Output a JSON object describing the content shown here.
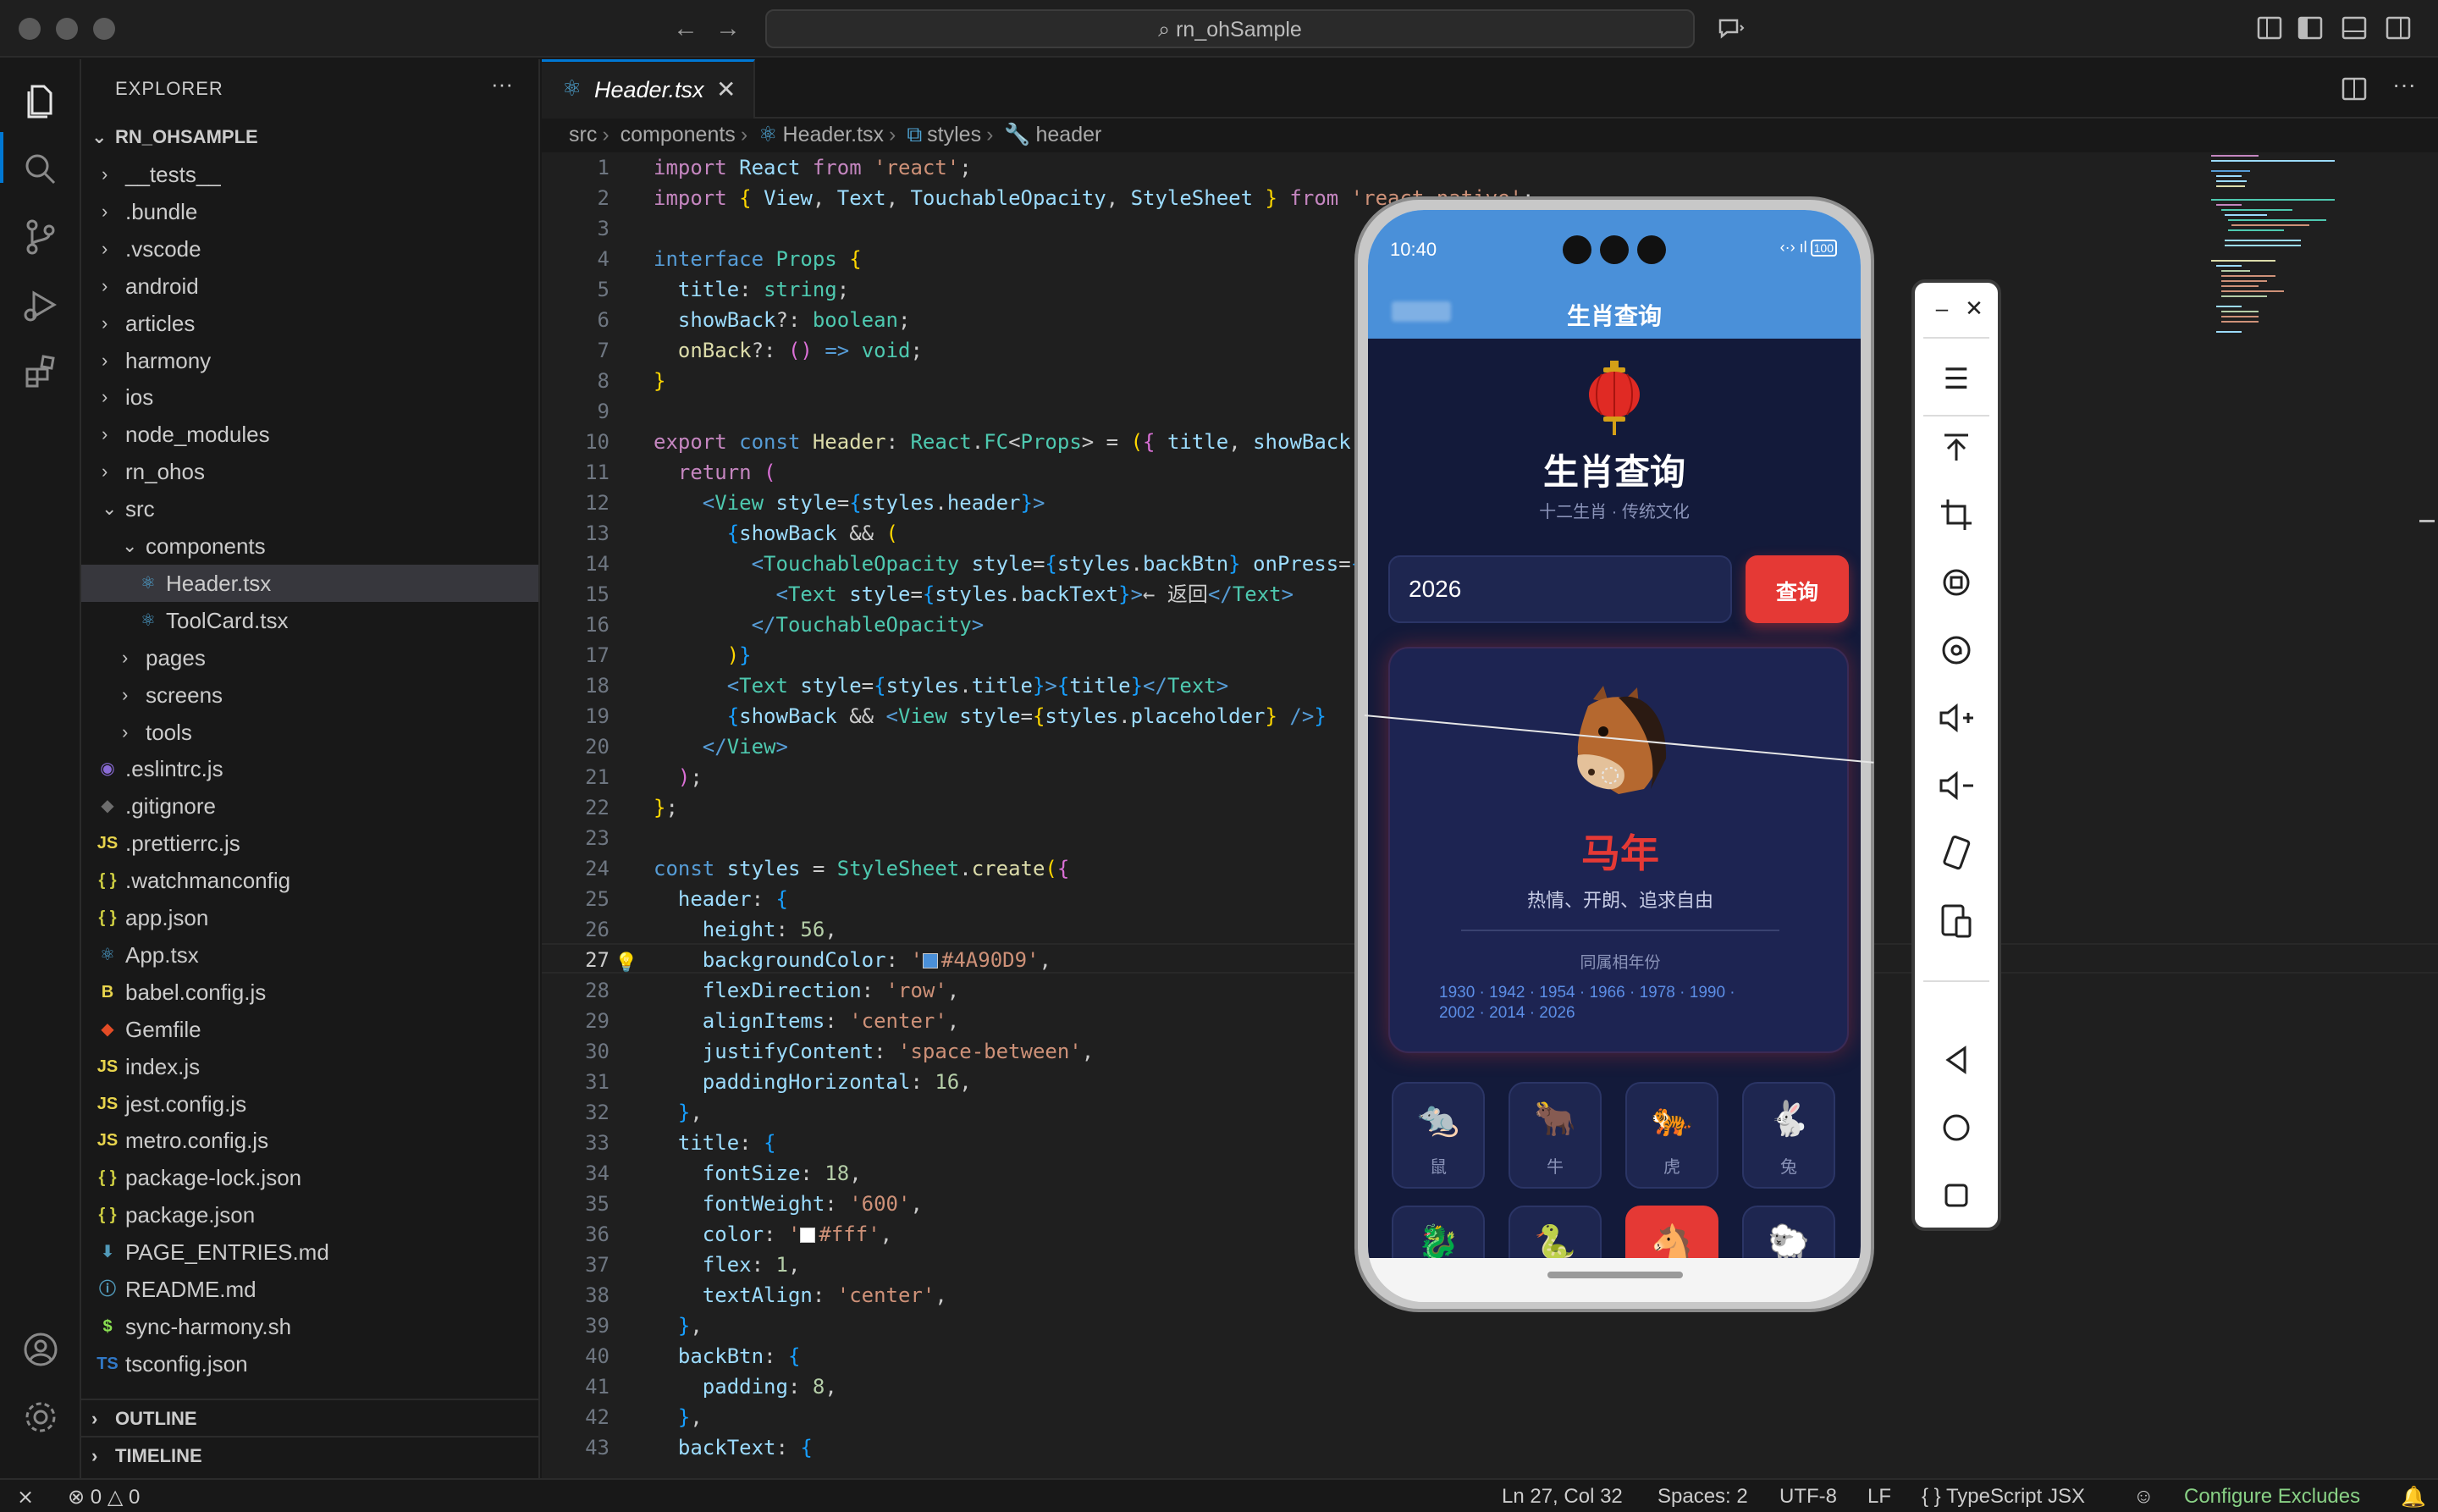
{
  "window": {
    "search_text": "rn_ohSample"
  },
  "sidebar": {
    "title": "EXPLORER",
    "more": "···",
    "root": "RN_OHSAMPLE",
    "items": [
      {
        "label": "__tests__",
        "kind": "folder",
        "depth": 1
      },
      {
        "label": ".bundle",
        "kind": "folder",
        "depth": 1
      },
      {
        "label": ".vscode",
        "kind": "folder",
        "depth": 1
      },
      {
        "label": "android",
        "kind": "folder",
        "depth": 1
      },
      {
        "label": "articles",
        "kind": "folder",
        "depth": 1
      },
      {
        "label": "harmony",
        "kind": "folder",
        "depth": 1
      },
      {
        "label": "ios",
        "kind": "folder",
        "depth": 1
      },
      {
        "label": "node_modules",
        "kind": "folder",
        "depth": 1
      },
      {
        "label": "rn_ohos",
        "kind": "folder",
        "depth": 1
      },
      {
        "label": "src",
        "kind": "folder-open",
        "depth": 1
      },
      {
        "label": "components",
        "kind": "folder-open",
        "depth": 2
      },
      {
        "label": "Header.tsx",
        "kind": "react",
        "depth": 3,
        "selected": true
      },
      {
        "label": "ToolCard.tsx",
        "kind": "react",
        "depth": 3
      },
      {
        "label": "pages",
        "kind": "folder",
        "depth": 2
      },
      {
        "label": "screens",
        "kind": "folder",
        "depth": 2
      },
      {
        "label": "tools",
        "kind": "folder",
        "depth": 2
      },
      {
        "label": ".eslintrc.js",
        "kind": "eslint",
        "depth": 1
      },
      {
        "label": ".gitignore",
        "kind": "git",
        "depth": 1
      },
      {
        "label": ".prettierrc.js",
        "kind": "js",
        "depth": 1
      },
      {
        "label": ".watchmanconfig",
        "kind": "json",
        "depth": 1
      },
      {
        "label": "app.json",
        "kind": "json",
        "depth": 1
      },
      {
        "label": "App.tsx",
        "kind": "react",
        "depth": 1
      },
      {
        "label": "babel.config.js",
        "kind": "babel",
        "depth": 1
      },
      {
        "label": "Gemfile",
        "kind": "ruby",
        "depth": 1
      },
      {
        "label": "index.js",
        "kind": "js",
        "depth": 1
      },
      {
        "label": "jest.config.js",
        "kind": "js",
        "depth": 1
      },
      {
        "label": "metro.config.js",
        "kind": "js",
        "depth": 1
      },
      {
        "label": "package-lock.json",
        "kind": "json",
        "depth": 1
      },
      {
        "label": "package.json",
        "kind": "json",
        "depth": 1
      },
      {
        "label": "PAGE_ENTRIES.md",
        "kind": "md",
        "depth": 1
      },
      {
        "label": "README.md",
        "kind": "info",
        "depth": 1
      },
      {
        "label": "sync-harmony.sh",
        "kind": "sh",
        "depth": 1
      },
      {
        "label": "tsconfig.json",
        "kind": "ts",
        "depth": 1
      }
    ],
    "outline": "OUTLINE",
    "timeline": "TIMELINE"
  },
  "file_icons": {
    "js": "JS",
    "json": "{ }",
    "sh": "$",
    "ts": "TS",
    "info": "ⓘ",
    "md": "⬇",
    "ruby": "◆",
    "babel": "B",
    "git": "◆",
    "eslint": "◉",
    "react": "⚛"
  },
  "editor": {
    "tab_label": "Header.tsx",
    "breadcrumb": [
      "src",
      "components",
      "Header.tsx",
      "styles",
      "header"
    ],
    "current_line": 27
  },
  "statusbar": {
    "errors": "0",
    "warnings": "0",
    "position": "Ln 27, Col 32",
    "spaces": "Spaces: 2",
    "encoding": "UTF-8",
    "eol": "LF",
    "language": "TypeScript JSX",
    "configure": "Configure Excludes"
  },
  "colors": {
    "header_swatch": "#4A90D9",
    "fff_swatch": "#ffffff"
  },
  "phone": {
    "time": "10:40",
    "battery": "100",
    "app_title": "生肖查询",
    "hero_title": "生肖查询",
    "hero_subtitle": "十二生肖 · 传统文化",
    "year_value": "2026",
    "query_button": "查询",
    "zodiac_name": "马年",
    "zodiac_desc": "热情、开朗、追求自由",
    "years_label": "同属相年份",
    "years_line1": "1930 · 1942 · 1954 · 1966 · 1978 · 1990 ·",
    "years_line2": "2002 · 2014 · 2026",
    "grid": [
      {
        "emoji": "🐀",
        "label": "鼠"
      },
      {
        "emoji": "🐂",
        "label": "牛"
      },
      {
        "emoji": "🐅",
        "label": "虎"
      },
      {
        "emoji": "🐇",
        "label": "兔"
      },
      {
        "emoji": "🐉",
        "label": ""
      },
      {
        "emoji": "🐍",
        "label": ""
      },
      {
        "emoji": "🐴",
        "label": "",
        "active": true
      },
      {
        "emoji": "🐑",
        "label": ""
      }
    ],
    "hero_emoji": "🐴",
    "lantern_icon": "lantern"
  }
}
